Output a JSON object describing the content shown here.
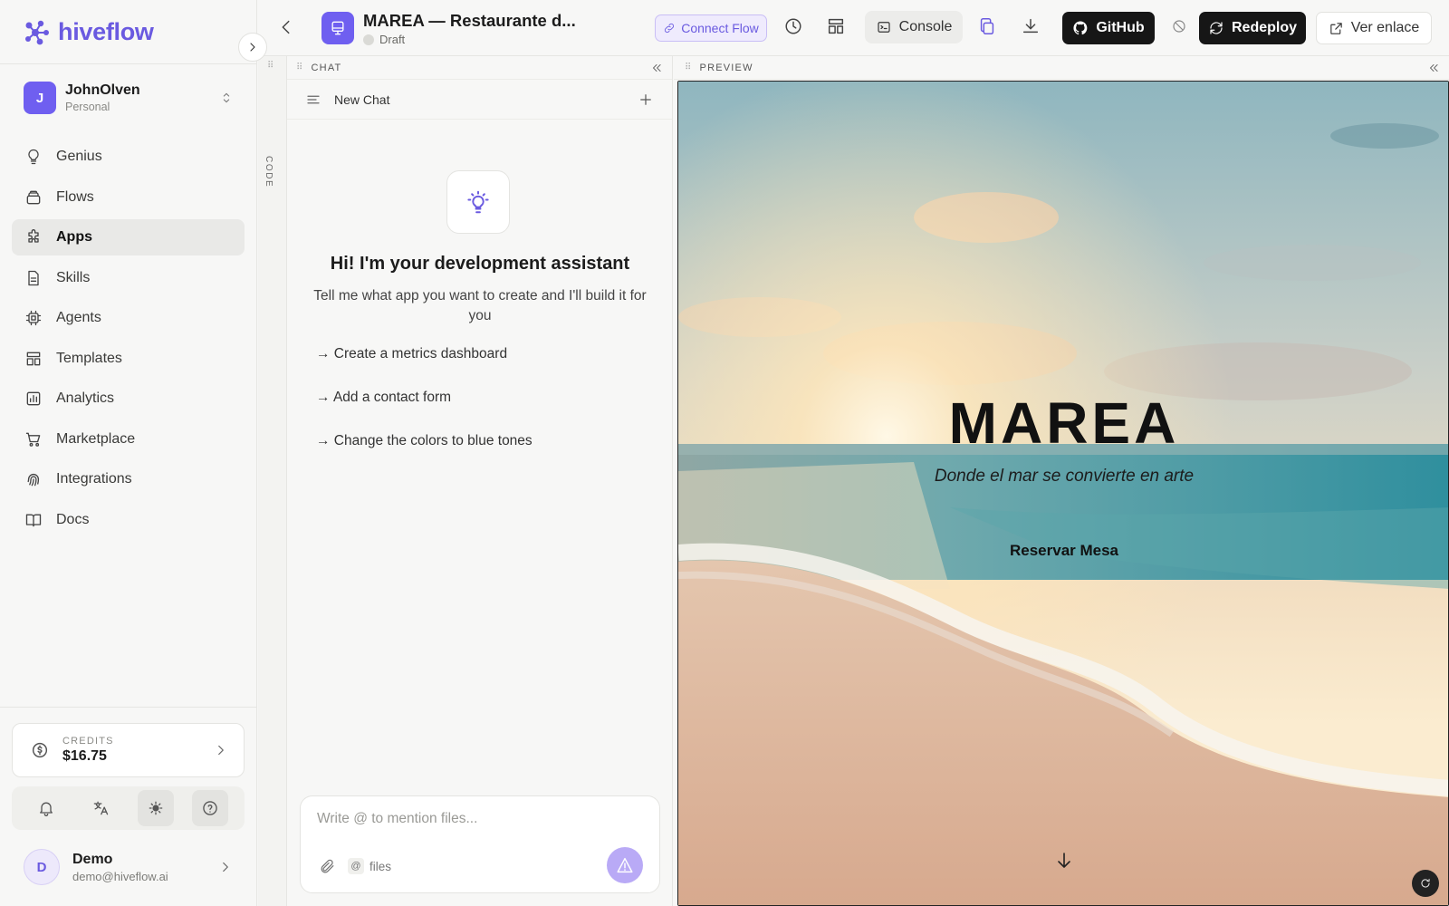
{
  "app": {
    "brand": "hiveflow"
  },
  "workspace": {
    "initial": "J",
    "name": "JohnOlven",
    "type": "Personal"
  },
  "nav": [
    {
      "label": "Genius",
      "icon": "bulb-icon"
    },
    {
      "label": "Flows",
      "icon": "layers-icon"
    },
    {
      "label": "Apps",
      "icon": "puzzle-icon",
      "active": true
    },
    {
      "label": "Skills",
      "icon": "file-icon"
    },
    {
      "label": "Agents",
      "icon": "cpu-icon"
    },
    {
      "label": "Templates",
      "icon": "layout-icon"
    },
    {
      "label": "Analytics",
      "icon": "chart-icon"
    },
    {
      "label": "Marketplace",
      "icon": "cart-icon"
    },
    {
      "label": "Integrations",
      "icon": "fingerprint-icon"
    },
    {
      "label": "Docs",
      "icon": "book-icon"
    }
  ],
  "credits": {
    "label": "CREDITS",
    "amount": "$16.75"
  },
  "user": {
    "initial": "D",
    "name": "Demo",
    "email": "demo@hiveflow.ai"
  },
  "topbar": {
    "project_title": "MAREA — Restaurante d...",
    "status": "Draft",
    "connect_flow": "Connect Flow",
    "console": "Console",
    "github": "GitHub",
    "redeploy": "Redeploy",
    "ver_enlace": "Ver enlace"
  },
  "rail": {
    "label": "CODE"
  },
  "chat": {
    "panel_label": "CHAT",
    "thread_title": "New Chat",
    "welcome_title": "Hi! I'm your development assistant",
    "welcome_sub": "Tell me what app you want to create and I'll build it for you",
    "suggestions": [
      "→ Create a metrics dashboard",
      "→ Add a contact form",
      "→ Change the colors to blue tones"
    ],
    "input_placeholder": "Write @ to mention files...",
    "files_label": "files",
    "at_symbol": "@"
  },
  "preview": {
    "panel_label": "PREVIEW",
    "hero_title": "MAREA",
    "hero_tagline": "Donde el mar se convierte en arte",
    "cta": "Reservar Mesa"
  },
  "colors": {
    "accent": "#6f5ff0",
    "dark_button": "#161616"
  }
}
